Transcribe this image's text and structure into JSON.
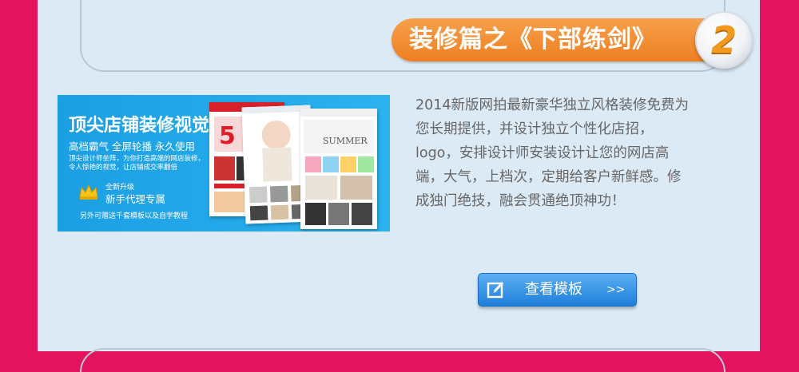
{
  "section": {
    "title": "装修篇之《下部练剑》",
    "number": "2"
  },
  "banner": {
    "title": "顶尖店铺装修视觉",
    "subtitle": "高档霸气  全屏轮播  永久使用",
    "desc_line1": "顶尖设计师坐阵，为你打造高端的网店装修，",
    "desc_line2": "令人惊艳的视觉，让店铺成交率翻倍",
    "upgrade": "全新升级",
    "agent": "新手代理专属",
    "extra": "另外可赠送千套模板以及自学教程",
    "shot1_number": "5",
    "shot3_text": "SUMMER"
  },
  "description": "2014新版网拍最新豪华独立风格装修免费为您长期提供，并设计独立个性化店招，logo，安排设计师安装设计让您的网店高端，大气，上档次，定期给客户新鲜感。修成独门绝技，融会贯通绝顶神功！",
  "button": {
    "label": "查看模板",
    "arrow": ">>"
  },
  "colors": {
    "page_border": "#e3145d",
    "panel": "#dceaf6",
    "title_orange": "#ee7f22",
    "banner_blue": "#1b9fe3",
    "button_blue": "#1f7ed9"
  }
}
